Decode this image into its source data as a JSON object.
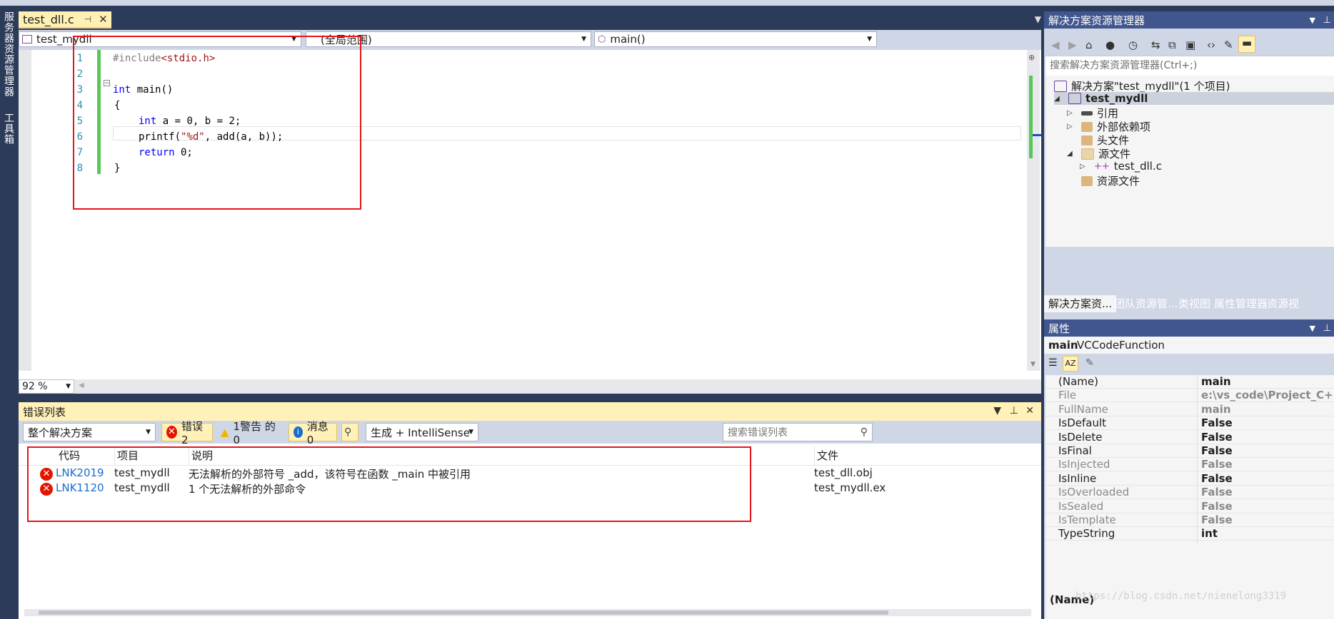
{
  "left_sidebar": {
    "tab1": "服务器资源管理器",
    "tab2": "工具箱"
  },
  "editor": {
    "tab_title": "test_dll.c",
    "nav": {
      "project": "test_mydll",
      "scope": "(全局范围)",
      "member": "main()"
    },
    "line_numbers": [
      "1",
      "2",
      "3",
      "4",
      "5",
      "6",
      "7",
      "8"
    ],
    "code": {
      "l1_pp": "#include",
      "l1_str": "<stdio.h>",
      "l3_kw": "int",
      "l3_rest": " main()",
      "l4": "{",
      "l5_kw": "int",
      "l5_rest": " a = 0, b = 2;",
      "l6_a": "printf(",
      "l6_str": "\"%d\"",
      "l6_b": ", add(a, b));",
      "l7_kw": "return",
      "l7_rest": " 0;",
      "l8": "}"
    },
    "zoom": "92 %"
  },
  "error_list": {
    "title": "错误列表",
    "scope": "整个解决方案",
    "errors_btn": "错误 2",
    "warnings_btn": "1警告 的 0",
    "messages_btn": "消息 0",
    "build_filter": "生成 + IntelliSense",
    "search_placeholder": "搜索错误列表",
    "columns": {
      "code": "代码",
      "project": "项目",
      "desc": "说明",
      "file": "文件"
    },
    "rows": [
      {
        "code": "LNK2019",
        "project": "test_mydll",
        "desc": "无法解析的外部符号 _add，该符号在函数 _main 中被引用",
        "file": "test_dll.obj"
      },
      {
        "code": "LNK1120",
        "project": "test_mydll",
        "desc": "1 个无法解析的外部命令",
        "file": "test_mydll.ex"
      }
    ]
  },
  "solution_explorer": {
    "title": "解决方案资源管理器",
    "search_placeholder": "搜索解决方案资源管理器(Ctrl+;)",
    "solution": "解决方案\"test_mydll\"(1 个项目)",
    "project": "test_mydll",
    "items": {
      "refs": "引用",
      "ext": "外部依赖项",
      "headers": "头文件",
      "sources": "源文件",
      "file": "test_dll.c",
      "resources": "资源文件"
    },
    "tabs": [
      "解决方案资...",
      "团队资源管...",
      "类视图",
      "属性管理器",
      "资源视"
    ]
  },
  "properties": {
    "title": "属性",
    "object_name": "main",
    "object_type": "VCCodeFunction",
    "rows": [
      {
        "key": "(Name)",
        "value": "main",
        "dim": false
      },
      {
        "key": "File",
        "value": "e:\\vs_code\\Project_C++\\t",
        "dim": true
      },
      {
        "key": "FullName",
        "value": "main",
        "dim": true
      },
      {
        "key": "IsDefault",
        "value": "False",
        "dim": false
      },
      {
        "key": "IsDelete",
        "value": "False",
        "dim": false
      },
      {
        "key": "IsFinal",
        "value": "False",
        "dim": false
      },
      {
        "key": "IsInjected",
        "value": "False",
        "dim": true
      },
      {
        "key": "IsInline",
        "value": "False",
        "dim": false
      },
      {
        "key": "IsOverloaded",
        "value": "False",
        "dim": true
      },
      {
        "key": "IsSealed",
        "value": "False",
        "dim": true
      },
      {
        "key": "IsTemplate",
        "value": "False",
        "dim": true
      },
      {
        "key": "TypeString",
        "value": "int",
        "dim": false
      }
    ],
    "footer": "(Name)",
    "watermark": "https://blog.csdn.net/nienelong3319"
  },
  "colors": {
    "accent_red": "#e3161c",
    "title_blue": "#40568d",
    "error_red": "#e51400"
  }
}
